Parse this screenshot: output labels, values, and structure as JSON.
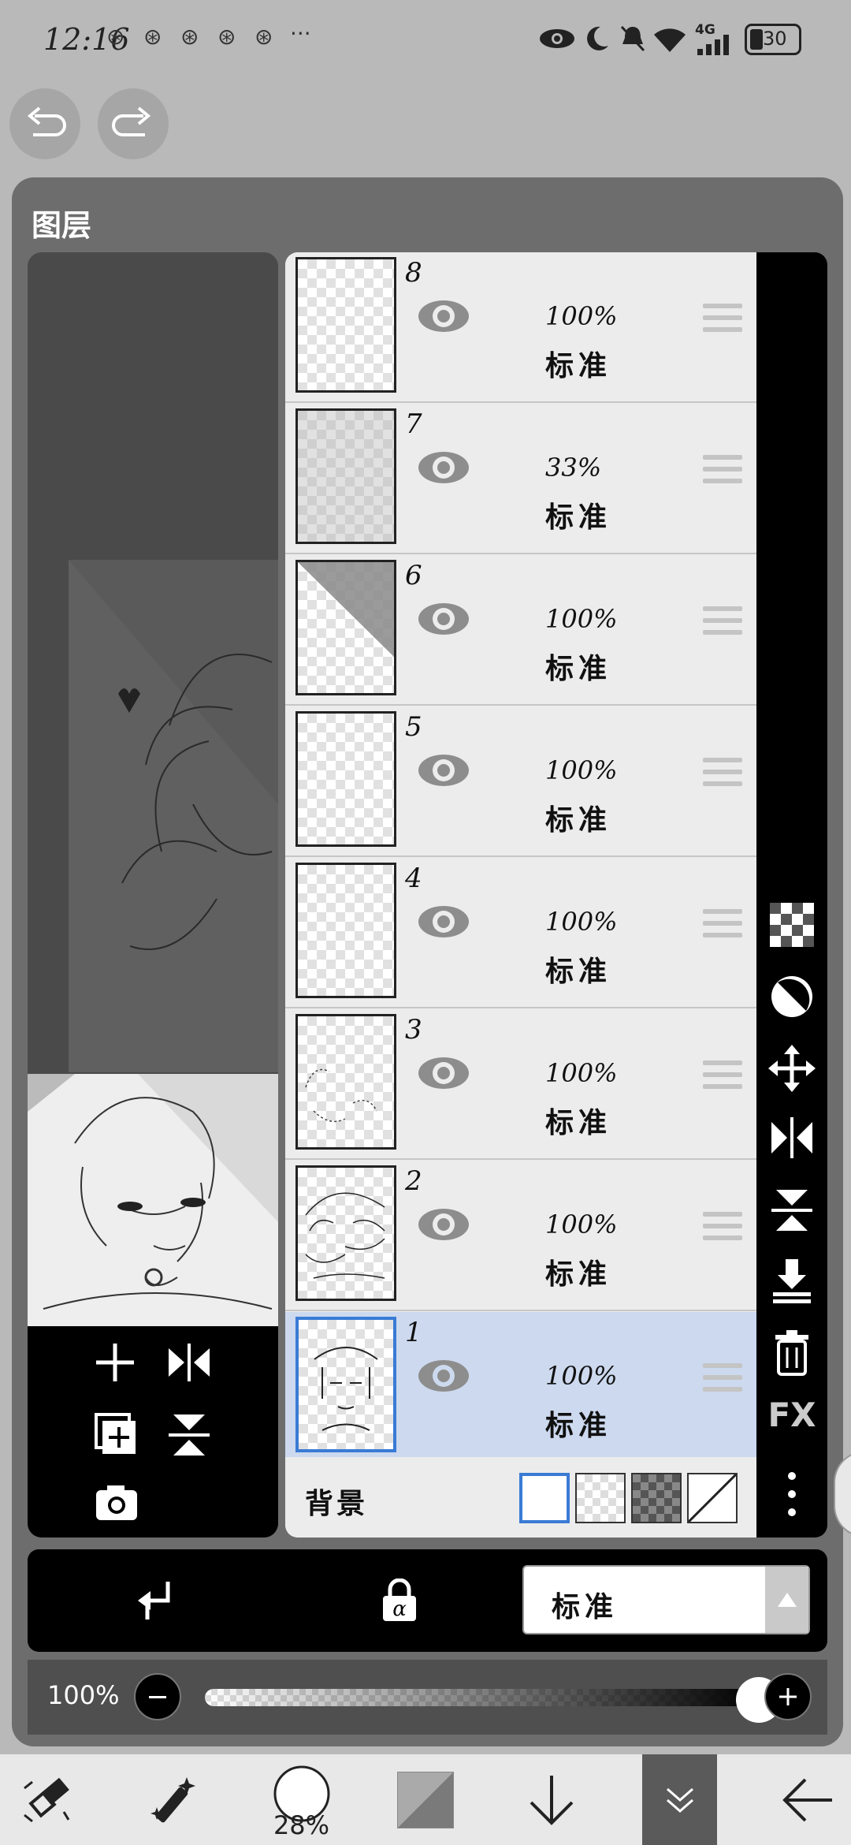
{
  "status_bar": {
    "time": "12:16",
    "battery": "30",
    "network": "4G",
    "icons": [
      "notification-icon",
      "notification-icon",
      "notification-icon",
      "notification-icon",
      "notification-icon",
      "more-dots-icon",
      "eye-icon",
      "moon-icon",
      "mute-icon",
      "wifi-icon",
      "signal-icon",
      "battery-icon"
    ]
  },
  "panel": {
    "title": "图层",
    "layers": [
      {
        "number": "8",
        "opacity": "100%",
        "blend": "标准",
        "selected": false
      },
      {
        "number": "7",
        "opacity": "33%",
        "blend": "标准",
        "selected": false
      },
      {
        "number": "6",
        "opacity": "100%",
        "blend": "标准",
        "selected": false
      },
      {
        "number": "5",
        "opacity": "100%",
        "blend": "标准",
        "selected": false
      },
      {
        "number": "4",
        "opacity": "100%",
        "blend": "标准",
        "selected": false
      },
      {
        "number": "3",
        "opacity": "100%",
        "blend": "标准",
        "selected": false
      },
      {
        "number": "2",
        "opacity": "100%",
        "blend": "标准",
        "selected": false
      },
      {
        "number": "1",
        "opacity": "100%",
        "blend": "标准",
        "selected": true
      }
    ],
    "background_label": "背景",
    "fx_label": "FX",
    "blend_mode": "标准",
    "opacity_label": "100%",
    "opacity_value": 1.0
  },
  "bottom_nav": {
    "brush_size": "28%"
  },
  "colors": {
    "panel_bg": "#6d6d6d",
    "selected_layer": "#ccd9ee",
    "accent": "#3a7bd5"
  }
}
